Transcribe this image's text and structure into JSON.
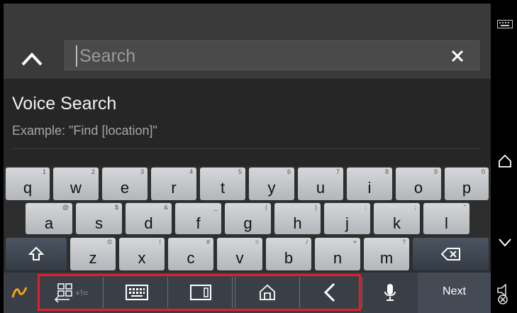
{
  "search": {
    "placeholder": "Search"
  },
  "voice": {
    "title": "Voice Search",
    "example": "Example: \"Find [location]\""
  },
  "keyboard": {
    "row1": [
      {
        "ch": "q",
        "hint": "1"
      },
      {
        "ch": "w",
        "hint": "2"
      },
      {
        "ch": "e",
        "hint": "3"
      },
      {
        "ch": "r",
        "hint": "4"
      },
      {
        "ch": "t",
        "hint": "5"
      },
      {
        "ch": "y",
        "hint": "6"
      },
      {
        "ch": "u",
        "hint": "7"
      },
      {
        "ch": "i",
        "hint": "8"
      },
      {
        "ch": "o",
        "hint": "9"
      },
      {
        "ch": "p",
        "hint": "0"
      }
    ],
    "row2": [
      {
        "ch": "a",
        "hint": "@"
      },
      {
        "ch": "s",
        "hint": "$"
      },
      {
        "ch": "d",
        "hint": "&"
      },
      {
        "ch": "f",
        "hint": "_"
      },
      {
        "ch": "g",
        "hint": "("
      },
      {
        "ch": "h",
        "hint": ")"
      },
      {
        "ch": "j",
        "hint": ":"
      },
      {
        "ch": "k",
        "hint": ";"
      },
      {
        "ch": "l",
        "hint": "\""
      }
    ],
    "row3": [
      {
        "ch": "z",
        "hint": "©"
      },
      {
        "ch": "x",
        "hint": "!"
      },
      {
        "ch": "c",
        "hint": "#"
      },
      {
        "ch": "v",
        "hint": "="
      },
      {
        "ch": "b",
        "hint": "/"
      },
      {
        "ch": "n",
        "hint": "+"
      },
      {
        "ch": "m",
        "hint": "?"
      }
    ],
    "symbol_label": "+!=",
    "next_label": "Next"
  },
  "colors": {
    "highlight": "#e0202a"
  }
}
